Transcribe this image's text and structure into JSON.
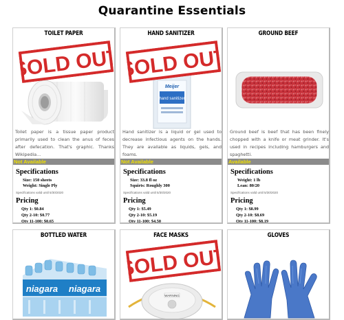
{
  "page": {
    "title": "Quarantine Essentials"
  },
  "colors": {
    "sold_out_red": "#d42a2a",
    "availability_bar": "#8b8b8b",
    "availability_text": "#f0e000"
  },
  "sold_out_label": "SOLD OUT",
  "products": [
    {
      "name": "TOILET PAPER",
      "sold_out": true,
      "description": "Toilet paper is a tissue paper product primarily used to clean the anus of feces after defecation. That's graphic. Thanks Wikipedia...",
      "availability": "Not Available",
      "spec_heading": "Specifications",
      "specs": [
        "Size: 150 sheets",
        "Weight: Single Ply"
      ],
      "spec_valid": "Specifications valid until 5/30/2020",
      "pricing_heading": "Pricing",
      "prices": [
        "Qty 1: $0.84",
        "Qty 2-10: $0.77",
        "Qty 11-100: $0.65"
      ],
      "icon": "toilet-paper-image"
    },
    {
      "name": "HAND SANITIZER",
      "sold_out": true,
      "description": "Hand sanitizer is a liquid or gel used to decrease infectious agents on the hands. They are available as liquids, gels, and foams.",
      "availability": "Not Available",
      "spec_heading": "Specifications",
      "specs": [
        "Size: 33.8 fl oz",
        "Squirts: Roughly 300"
      ],
      "spec_valid": "Specifications valid until 5/30/2020",
      "pricing_heading": "Pricing",
      "prices": [
        "Qty 1: $5.49",
        "Qty 2-10: $5.19",
        "Qty 11-100: $4.50"
      ],
      "icon": "sanitizer-bottle-image",
      "bottle_brand": "Meijer",
      "bottle_label": "hand sanitizer"
    },
    {
      "name": "GROUND BEEF",
      "sold_out": false,
      "description": "Ground beef is beef that has been finely chopped with a knife or meat grinder. It's used in recipes including hamburgers and spaghetti.",
      "availability": "Available",
      "spec_heading": "Specifications",
      "specs": [
        "Weight: 1 lb",
        "Lean: 80/20"
      ],
      "spec_valid": "Specifications valid until 5/30/2020",
      "pricing_heading": "Pricing",
      "prices": [
        "Qty 1: $8.99",
        "Qty 2-10: $8.69",
        "Qty 11-100: $8.19"
      ],
      "icon": "ground-beef-image"
    },
    {
      "name": "BOTTLED WATER",
      "sold_out": false,
      "icon": "bottled-water-image",
      "brand": "niagara"
    },
    {
      "name": "FACE MASKS",
      "sold_out": true,
      "icon": "face-mask-image",
      "mask_label": "WARNING"
    },
    {
      "name": "GLOVES",
      "sold_out": false,
      "icon": "gloves-image"
    }
  ]
}
